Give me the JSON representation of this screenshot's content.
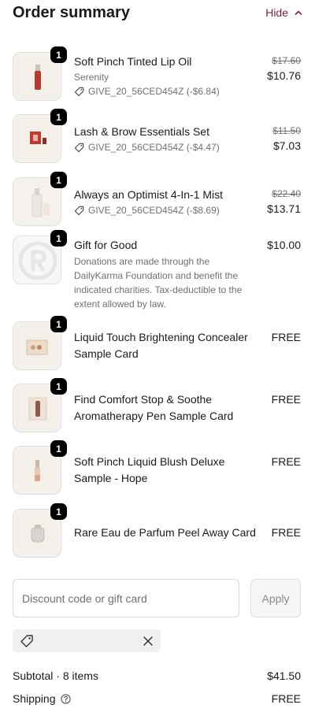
{
  "header": {
    "title": "Order summary",
    "toggle_label": "Hide"
  },
  "items": [
    {
      "qty": "1",
      "name": "Soft Pinch Tinted Lip Oil",
      "variant": "Serenity",
      "discount": "GIVE_20_56CED454Z (-$6.84)",
      "original_price": "$17.60",
      "price": "$10.76"
    },
    {
      "qty": "1",
      "name": "Lash & Brow Essentials Set",
      "discount": "GIVE_20_56CED454Z (-$4.47)",
      "original_price": "$11.50",
      "price": "$7.03"
    },
    {
      "qty": "1",
      "name": "Always an Optimist 4-In-1 Mist",
      "discount": "GIVE_20_56CED454Z (-$8.69)",
      "original_price": "$22.40",
      "price": "$13.71"
    },
    {
      "qty": "1",
      "name": "Gift for Good",
      "description": "Donations are made through the DailyKarma Foundation and benefit the indicated charities. Tax-deductible to the extent allowed by law.",
      "price": "$10.00"
    },
    {
      "qty": "1",
      "name": "Liquid Touch Brightening Concealer Sample Card",
      "price": "FREE"
    },
    {
      "qty": "1",
      "name": "Find Comfort Stop & Soothe Aromatherapy Pen Sample Card",
      "price": "FREE"
    },
    {
      "qty": "1",
      "name": "Soft Pinch Liquid Blush Deluxe Sample - Hope",
      "price": "FREE"
    },
    {
      "qty": "1",
      "name": "Rare Eau de Parfum Peel Away Card",
      "price": "FREE"
    }
  ],
  "discount_form": {
    "placeholder": "Discount code or gift card",
    "apply_label": "Apply"
  },
  "summary": {
    "subtotal_label": "Subtotal · 8 items",
    "subtotal_value": "$41.50",
    "shipping_label": "Shipping",
    "shipping_value": "FREE"
  },
  "colors": {
    "accent": "#7a1f3d",
    "badge": "#000000",
    "muted_text": "#707070"
  },
  "icons": {
    "toggle": "chevron-up-icon",
    "discount": "tag-icon",
    "remove": "close-icon",
    "shipping_help": "help-circle-icon"
  }
}
